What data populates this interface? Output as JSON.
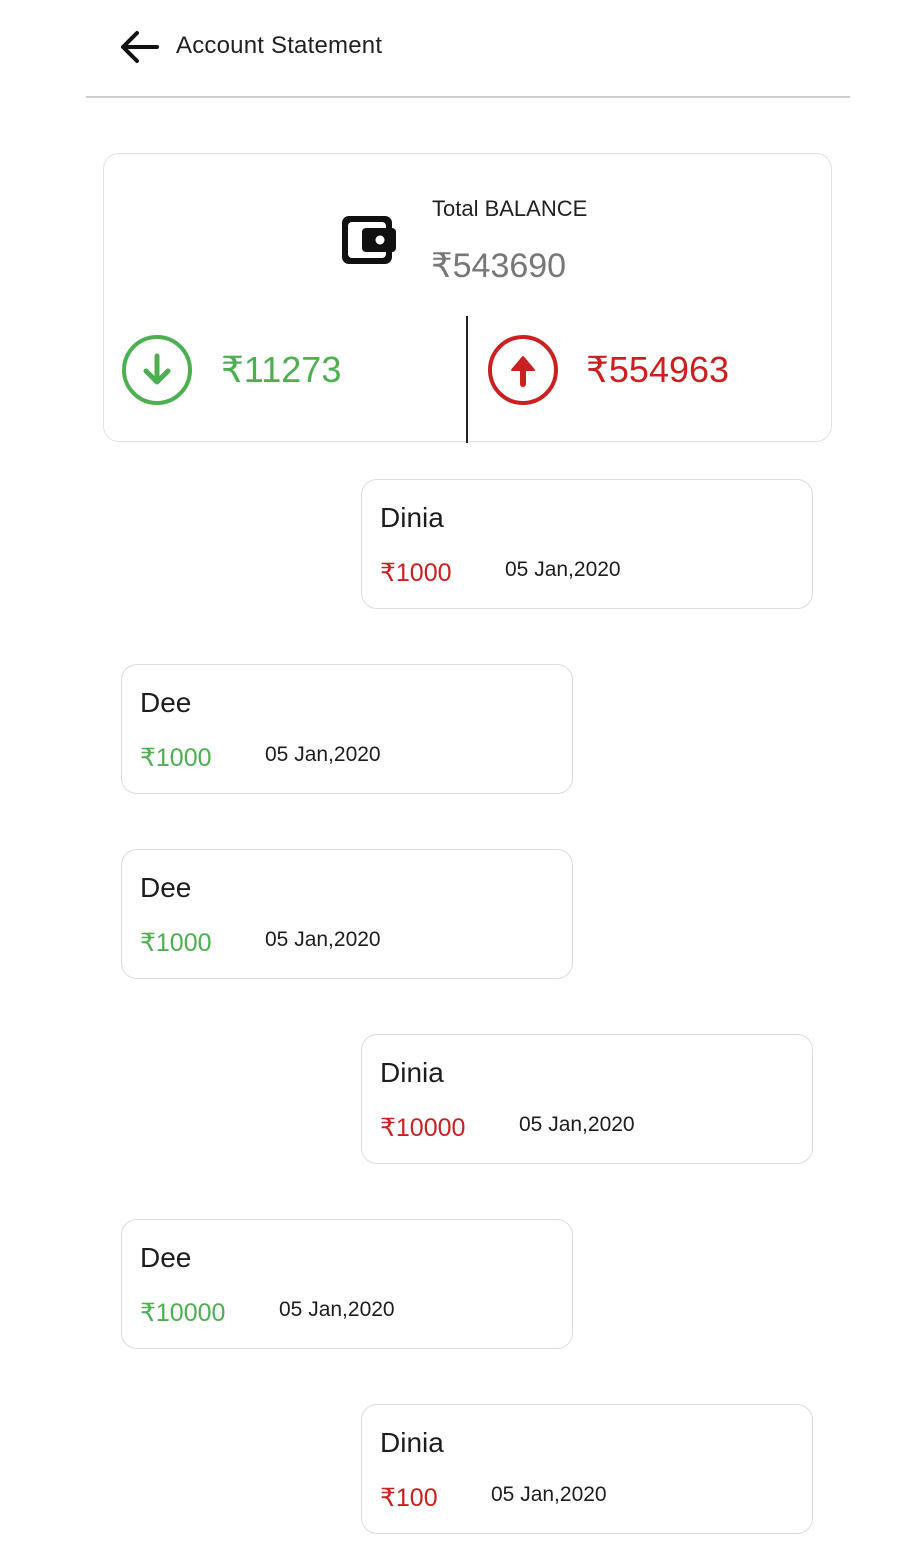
{
  "header": {
    "title": "Account Statement",
    "back_icon": "arrow-left-icon"
  },
  "summary": {
    "wallet_icon": "wallet-icon",
    "total_label": "Total BALANCE",
    "total_value": "₹543690",
    "in_icon": "arrow-down-circle-icon",
    "in_value": "₹11273",
    "out_icon": "arrow-up-circle-icon",
    "out_value": "₹554963"
  },
  "transactions": [
    {
      "name": "Dinia",
      "amount": "₹1000",
      "date": "05 Jan,2020",
      "type": "debit"
    },
    {
      "name": "Dee",
      "amount": "₹1000",
      "date": "05 Jan,2020",
      "type": "credit"
    },
    {
      "name": "Dee",
      "amount": "₹1000",
      "date": "05 Jan,2020",
      "type": "credit"
    },
    {
      "name": "Dinia",
      "amount": "₹10000",
      "date": "05 Jan,2020",
      "type": "debit"
    },
    {
      "name": "Dee",
      "amount": "₹10000",
      "date": "05 Jan,2020",
      "type": "credit"
    },
    {
      "name": "Dinia",
      "amount": "₹100",
      "date": "05 Jan,2020",
      "type": "debit"
    }
  ],
  "colors": {
    "credit": "#4caf50",
    "debit": "#cc1f1f",
    "total_value": "#777777"
  }
}
